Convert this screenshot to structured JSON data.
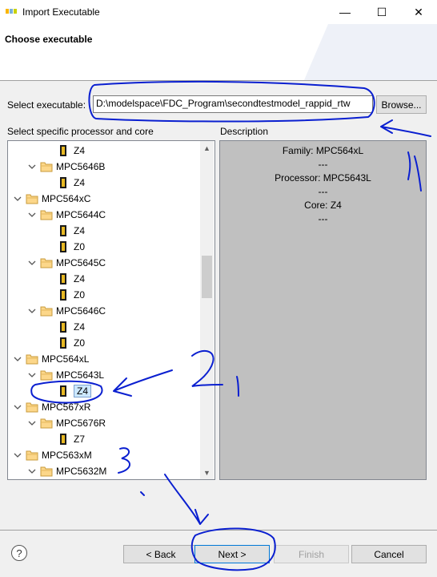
{
  "window": {
    "title": "Import Executable",
    "minimize": "—",
    "maximize": "☐",
    "close": "✕"
  },
  "header": {
    "title": "Choose executable"
  },
  "executable": {
    "label": "Select executable:",
    "value": "D:\\modelspace\\FDC_Program\\secondtestmodel_rappid_rtw",
    "browse_label": "Browse..."
  },
  "tree": {
    "label": "Select specific processor and core",
    "items": [
      {
        "label": "Z4",
        "kind": "core",
        "level": 2
      },
      {
        "label": "MPC5646B",
        "kind": "processor",
        "level": 1
      },
      {
        "label": "Z4",
        "kind": "core",
        "level": 2
      },
      {
        "label": "MPC564xC",
        "kind": "family",
        "level": 0
      },
      {
        "label": "MPC5644C",
        "kind": "processor",
        "level": 1
      },
      {
        "label": "Z4",
        "kind": "core",
        "level": 2
      },
      {
        "label": "Z0",
        "kind": "core",
        "level": 2
      },
      {
        "label": "MPC5645C",
        "kind": "processor",
        "level": 1
      },
      {
        "label": "Z4",
        "kind": "core",
        "level": 2
      },
      {
        "label": "Z0",
        "kind": "core",
        "level": 2
      },
      {
        "label": "MPC5646C",
        "kind": "processor",
        "level": 1
      },
      {
        "label": "Z4",
        "kind": "core",
        "level": 2
      },
      {
        "label": "Z0",
        "kind": "core",
        "level": 2
      },
      {
        "label": "MPC564xL",
        "kind": "family",
        "level": 0
      },
      {
        "label": "MPC5643L",
        "kind": "processor",
        "level": 1
      },
      {
        "label": "Z4",
        "kind": "core",
        "level": 2,
        "selected": true
      },
      {
        "label": "MPC567xR",
        "kind": "family",
        "level": 0
      },
      {
        "label": "MPC5676R",
        "kind": "processor",
        "level": 1
      },
      {
        "label": "Z7",
        "kind": "core",
        "level": 2
      },
      {
        "label": "MPC563xM",
        "kind": "family",
        "level": 0
      },
      {
        "label": "MPC5632M",
        "kind": "processor",
        "level": 1
      }
    ]
  },
  "description": {
    "label": "Description",
    "lines": [
      "Family: MPC564xL",
      "---",
      "Processor: MPC5643L",
      "---",
      "Core: Z4",
      "---"
    ]
  },
  "buttons": {
    "help": "?",
    "back": "< Back",
    "next": "Next >",
    "finish": "Finish",
    "cancel": "Cancel"
  },
  "colors": {
    "annotation_ink": "#0a1fd0",
    "selection": "#cce8ff",
    "description_bg": "#c0c0c0"
  }
}
